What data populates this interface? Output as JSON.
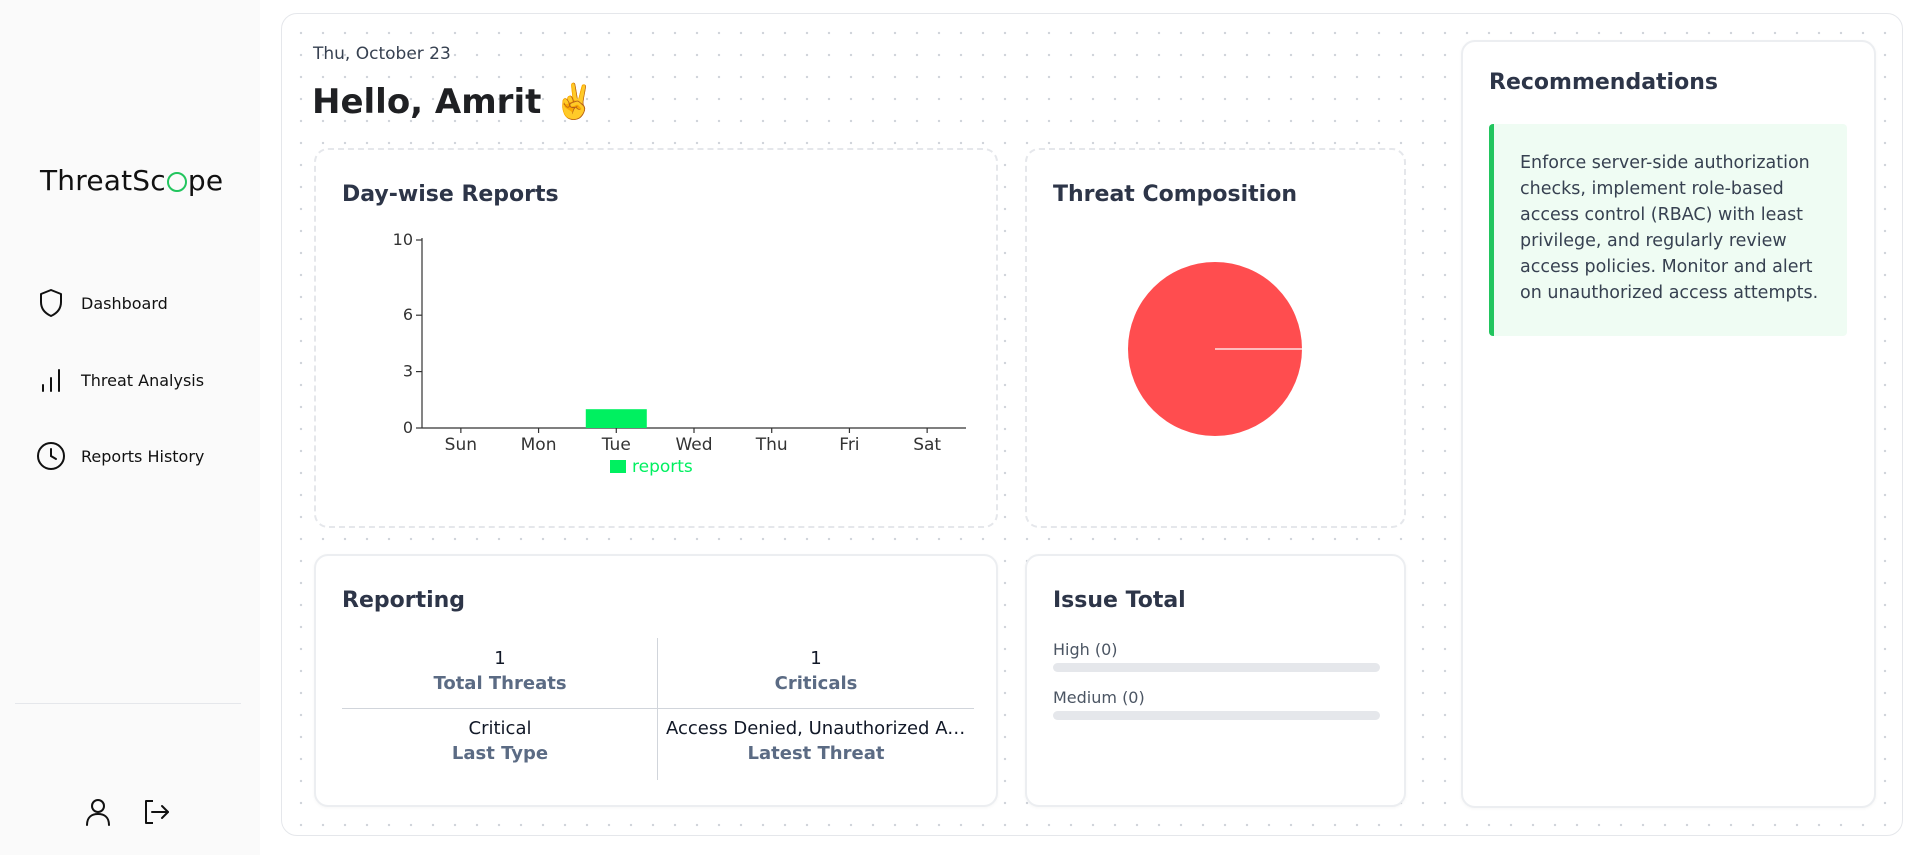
{
  "sidebar": {
    "logo_prefix": "ThreatSc",
    "logo_suffix": "pe",
    "items": [
      {
        "label": "Dashboard",
        "icon": "shield-icon"
      },
      {
        "label": "Threat Analysis",
        "icon": "bar-chart-icon"
      },
      {
        "label": "Reports History",
        "icon": "clock-icon"
      }
    ],
    "bottom_icons": [
      "user-icon",
      "logout-icon"
    ]
  },
  "header": {
    "date": "Thu, October 23",
    "greeting": "Hello, Amrit ✌️"
  },
  "cards": {
    "day_wise_title": "Day-wise Reports",
    "composition_title": "Threat Composition",
    "reporting_title": "Reporting",
    "issue_title": "Issue Total",
    "recommendations_title": "Recommendations"
  },
  "chart_data": [
    {
      "type": "bar",
      "categories": [
        "Sun",
        "Mon",
        "Tue",
        "Wed",
        "Thu",
        "Fri",
        "Sat"
      ],
      "series": [
        {
          "name": "reports",
          "values": [
            0,
            0,
            1,
            0,
            0,
            0,
            0
          ],
          "color": "#00f060"
        }
      ],
      "yticks": [
        0,
        3,
        6,
        10
      ],
      "ylim": [
        0,
        10
      ],
      "legend_position": "bottom-center"
    },
    {
      "type": "pie",
      "slices": [
        {
          "value": 1,
          "color": "#ff4d4f"
        }
      ]
    }
  ],
  "reporting": {
    "total_threats_value": "1",
    "total_threats_label": "Total Threats",
    "criticals_value": "1",
    "criticals_label": "Criticals",
    "last_type_value": "Critical",
    "last_type_label": "Last Type",
    "latest_threat_value": "Access Denied, Unauthorized Ac...",
    "latest_threat_label": "Latest Threat"
  },
  "issue_total": {
    "high_label": "High (0)",
    "high_fraction": 0,
    "medium_label": "Medium (0)",
    "medium_fraction": 0
  },
  "recommendation": {
    "text": "Enforce server-side authorization checks, implement role-based access control (RBAC) with least privilege, and regularly review access policies. Monitor and alert on unauthorized access attempts."
  },
  "colors": {
    "accent_green": "#22c55e",
    "bar_green": "#00f060",
    "pie_red": "#ff4d4f"
  }
}
